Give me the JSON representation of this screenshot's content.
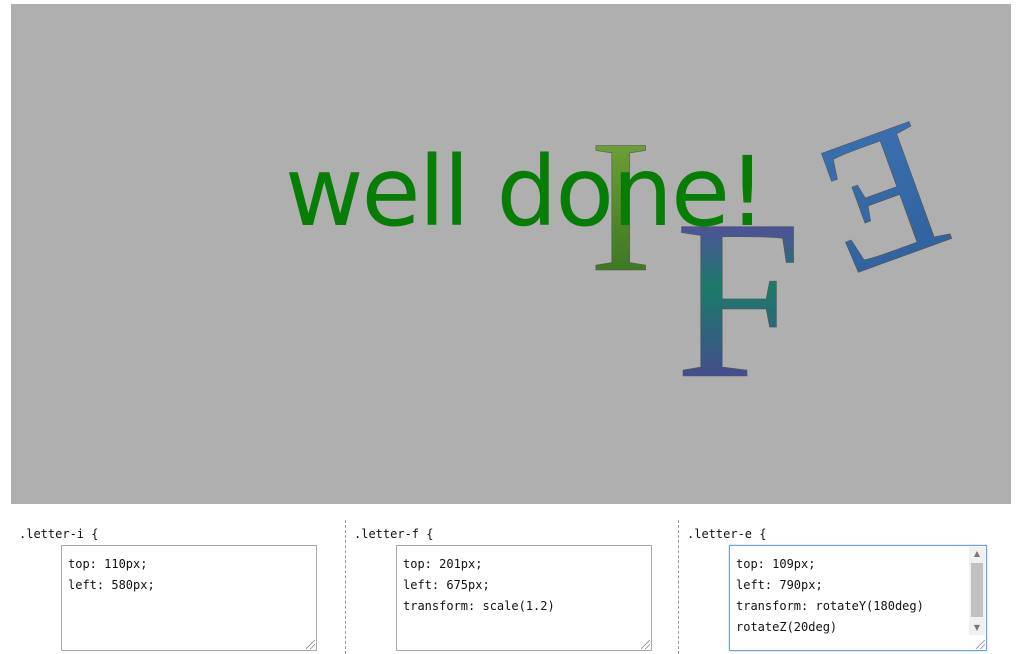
{
  "stage": {
    "background": "#afafaf",
    "message": "well done!",
    "message_color": "#067e06",
    "letters": {
      "i": "I",
      "f": "F",
      "e": "E"
    }
  },
  "panels": [
    {
      "selector": ".letter-i {",
      "lines": [
        "top: 110px;",
        "left: 580px;"
      ]
    },
    {
      "selector": ".letter-f {",
      "lines": [
        "top: 201px;",
        "left: 675px;",
        "transform: scale(1.2)"
      ]
    },
    {
      "selector": ".letter-e {",
      "lines": [
        "top: 109px;",
        "left: 790px;",
        "transform: rotateY(180deg)",
        "rotateZ(20deg)"
      ]
    }
  ],
  "icons": {
    "scroll_up": "scroll-up-arrow-icon",
    "scroll_down": "scroll-down-arrow-icon",
    "resize": "resize-grip-icon"
  }
}
